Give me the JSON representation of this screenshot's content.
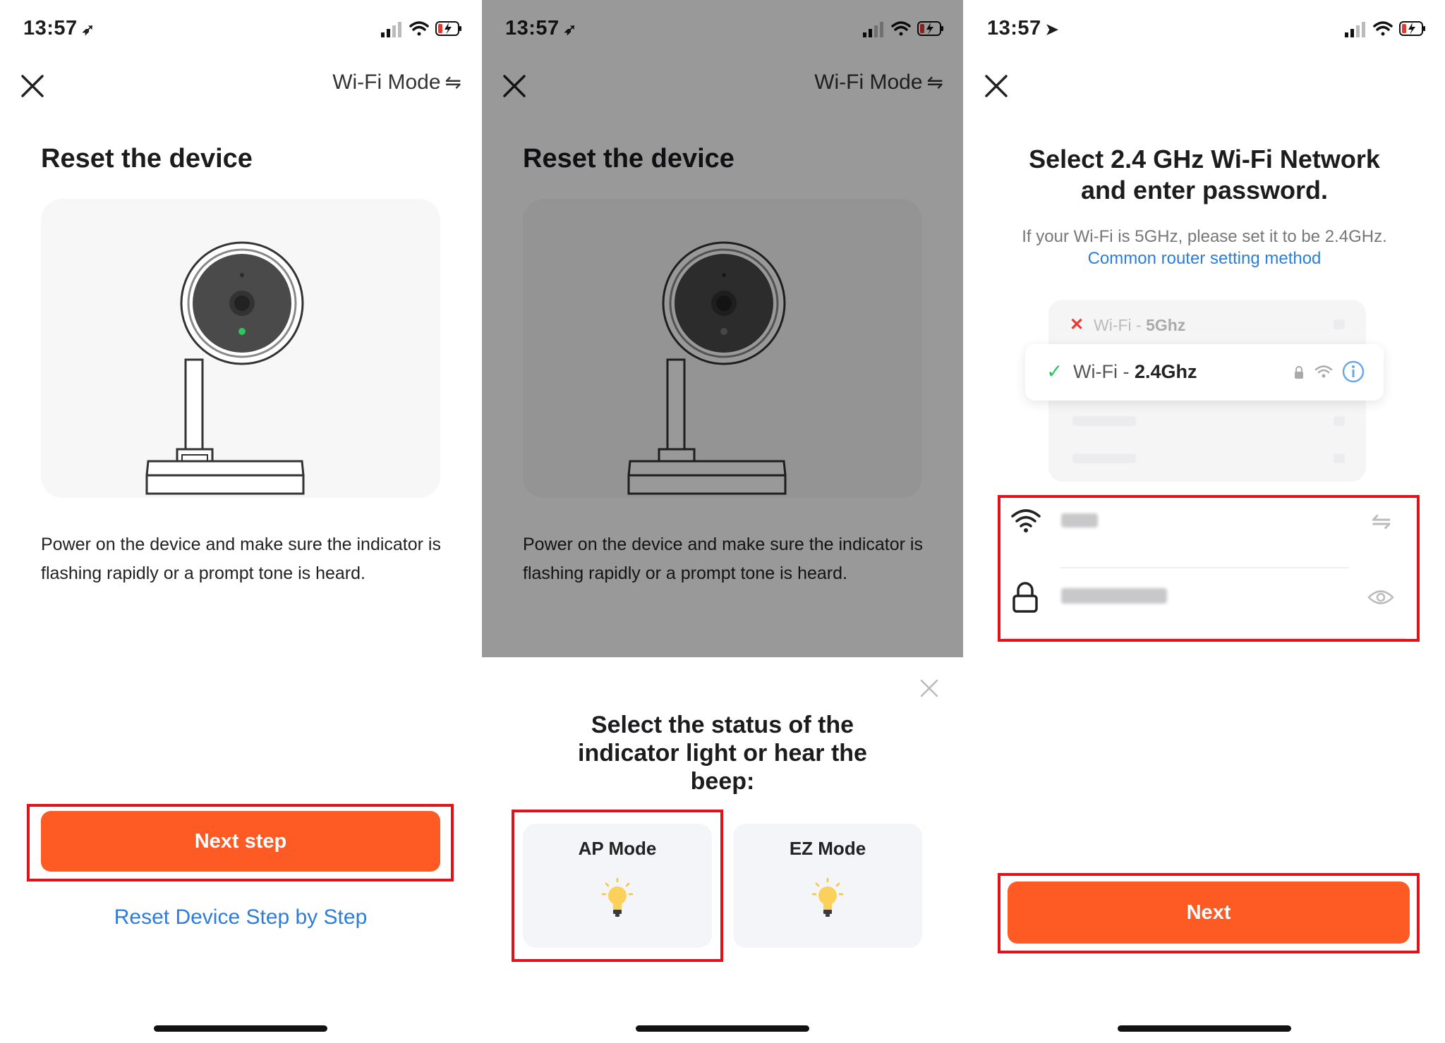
{
  "panel1": {
    "time": "13:57",
    "mode_link": "Wi-Fi Mode",
    "title": "Reset the device",
    "description": "Power on the device and make sure the indicator is flashing rapidly or a prompt tone is heard.",
    "next_button": "Next step",
    "reset_link": "Reset Device Step by Step"
  },
  "panel2": {
    "time": "13:57",
    "mode_link": "Wi-Fi Mode",
    "title": "Reset the device",
    "description": "Power on the device and make sure the indicator is flashing rapidly or a prompt tone is heard.",
    "sheet_title": "Select the status of the indicator light or hear the beep:",
    "options": [
      {
        "label": "AP Mode"
      },
      {
        "label": "EZ Mode"
      }
    ]
  },
  "panel3": {
    "time": "13:57",
    "title": "Select 2.4 GHz Wi-Fi Network and enter password.",
    "note_prefix": "If your Wi-Fi is 5GHz, please set it to be 2.4GHz.",
    "note_link": "Common router setting method",
    "wifi_5g_prefix": "Wi-Fi - ",
    "wifi_5g_band": "5Ghz",
    "wifi_24_prefix": "Wi-Fi - ",
    "wifi_24_band": "2.4Ghz",
    "next_button": "Next"
  },
  "colors": {
    "accent_orange": "#fd5a24",
    "link_blue": "#2d7dd8",
    "highlight_red": "#e0131b",
    "indicator_green": "#2ec65a"
  },
  "icons": [
    "location-arrow-icon",
    "signal-icon",
    "wifi-icon",
    "battery-charging-icon",
    "close-icon",
    "swap-arrows-icon",
    "camera-illustration",
    "bulb-icon",
    "lock-icon",
    "eye-icon",
    "info-icon",
    "check-icon"
  ]
}
